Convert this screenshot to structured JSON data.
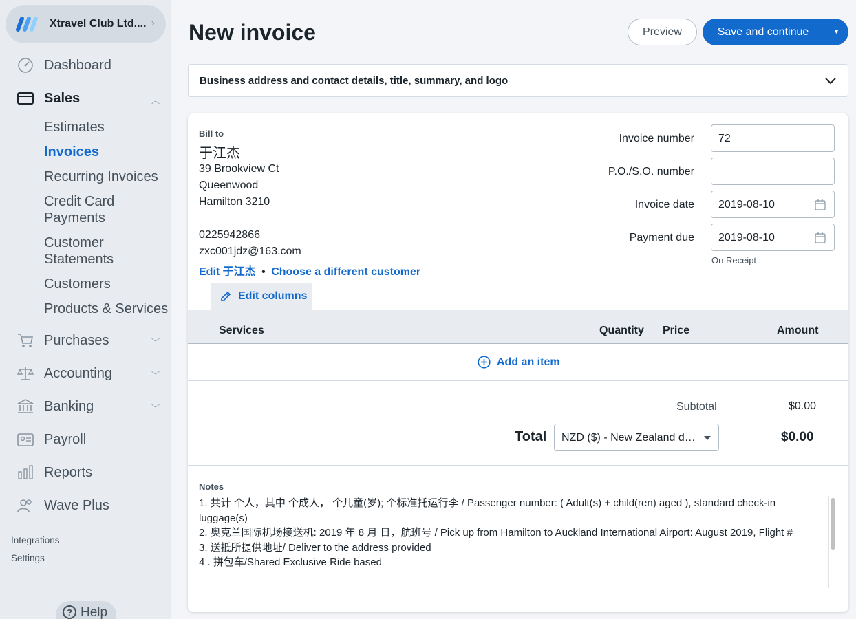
{
  "sidebar": {
    "business_name": "Xtravel Club Ltd....",
    "nav": [
      {
        "label": "Dashboard",
        "icon": "dashboard-icon"
      },
      {
        "label": "Sales",
        "icon": "sales-icon"
      },
      {
        "label": "Purchases",
        "icon": "cart-icon"
      },
      {
        "label": "Accounting",
        "icon": "scale-icon"
      },
      {
        "label": "Banking",
        "icon": "bank-icon"
      },
      {
        "label": "Payroll",
        "icon": "payroll-icon"
      },
      {
        "label": "Reports",
        "icon": "reports-icon"
      },
      {
        "label": "Wave Plus",
        "icon": "people-icon"
      }
    ],
    "sales_sub": [
      {
        "label": "Estimates"
      },
      {
        "label": "Invoices",
        "active": true
      },
      {
        "label": "Recurring Invoices"
      },
      {
        "label": "Credit Card\nPayments"
      },
      {
        "label": "Customer\nStatements"
      },
      {
        "label": "Customers"
      },
      {
        "label": "Products & Services"
      }
    ],
    "integrations": "Integrations",
    "settings": "Settings",
    "help": "Help"
  },
  "header": {
    "title": "New invoice",
    "preview_label": "Preview",
    "save_label": "Save and continue"
  },
  "accordion_label": "Business address and contact details, title, summary, and logo",
  "bill_to": {
    "label": "Bill to",
    "name": "于江杰",
    "address1": "39 Brookview Ct",
    "address2": "Queenwood",
    "address3": "Hamilton 3210",
    "phone": "0225942866",
    "email": "zxc001jdz@163.com",
    "edit_link": "Edit 于江杰",
    "bullet": "•",
    "choose_link": "Choose a different customer"
  },
  "invoice_fields": {
    "number_label": "Invoice number",
    "number_value": "72",
    "po_label": "P.O./S.O. number",
    "po_value": "",
    "date_label": "Invoice date",
    "date_value": "2019-08-10",
    "due_label": "Payment due",
    "due_value": "2019-08-10",
    "due_note": "On Receipt"
  },
  "items": {
    "edit_columns": "Edit columns",
    "col_services": "Services",
    "col_quantity": "Quantity",
    "col_price": "Price",
    "col_amount": "Amount",
    "add_item": "Add an item"
  },
  "totals": {
    "subtotal_label": "Subtotal",
    "subtotal_value": "$0.00",
    "total_label": "Total",
    "currency": "NZD ($) - New Zealand dollar",
    "total_value": "$0.00"
  },
  "notes": {
    "label": "Notes",
    "lines": [
      "1. 共计  个人，其中  个成人，   个儿童(岁);   个标准托运行李 / Passenger number:  (   Adult(s) +   child(ren) aged  ),   standard check-in luggage(s)",
      "2. 奥克兰国际机场接送机: 2019 年 8 月   日，航班号 / Pick up from Hamilton to Auckland International Airport:   August 2019, Flight #",
      "3. 送抵所提供地址/ Deliver to the address provided",
      "4 . 拼包车/Shared Exclusive Ride based"
    ]
  },
  "colors": {
    "accent": "#136acd",
    "sidebar_bg": "#e8ecf1",
    "text": "#1c252c"
  }
}
